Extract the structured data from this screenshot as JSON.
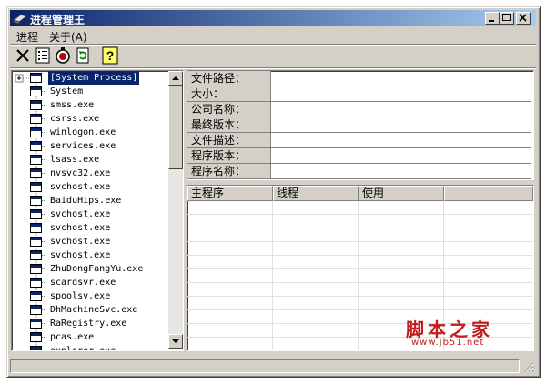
{
  "window": {
    "title": "进程管理王",
    "controls": {
      "minimize": "_",
      "maximize": "□",
      "close": "×"
    }
  },
  "menu": [
    {
      "label": "进程"
    },
    {
      "label": "关于(A)"
    }
  ],
  "toolbar": [
    {
      "name": "kill-icon",
      "glyph": "✕"
    },
    {
      "name": "details-icon",
      "glyph": "▦"
    },
    {
      "name": "clock-icon",
      "glyph": "◷"
    },
    {
      "name": "refresh-icon",
      "glyph": "↻"
    },
    {
      "name": "help-icon",
      "glyph": "?"
    }
  ],
  "tree": {
    "expander": "+",
    "items": [
      "[System Process]",
      "System",
      "smss.exe",
      "csrss.exe",
      "winlogon.exe",
      "services.exe",
      "lsass.exe",
      "nvsvc32.exe",
      "svchost.exe",
      "BaiduHips.exe",
      "svchost.exe",
      "svchost.exe",
      "svchost.exe",
      "svchost.exe",
      "ZhuDongFangYu.exe",
      "scardsvr.exe",
      "spoolsv.exe",
      "DhMachineSvc.exe",
      "RaRegistry.exe",
      "pcas.exe",
      "explorer.exe"
    ],
    "selected_index": 0,
    "scroll_position": 0.0
  },
  "info": {
    "fields": [
      {
        "label": "文件路径：",
        "value": ""
      },
      {
        "label": "大小：",
        "value": ""
      },
      {
        "label": "公司名称：",
        "value": ""
      },
      {
        "label": "最终版本：",
        "value": ""
      },
      {
        "label": "文件描述：",
        "value": ""
      },
      {
        "label": "程序版本：",
        "value": ""
      },
      {
        "label": "程序名称：",
        "value": ""
      }
    ]
  },
  "modules": {
    "columns": [
      "主程序",
      "线程",
      "使用"
    ]
  },
  "watermark": {
    "title": "脚本之家",
    "url": "www.jb51.net"
  },
  "colors": {
    "titlebar_start": "#0a246a",
    "titlebar_end": "#a6caf0",
    "face": "#d4d0c8",
    "watermark": "#c21b1b"
  }
}
